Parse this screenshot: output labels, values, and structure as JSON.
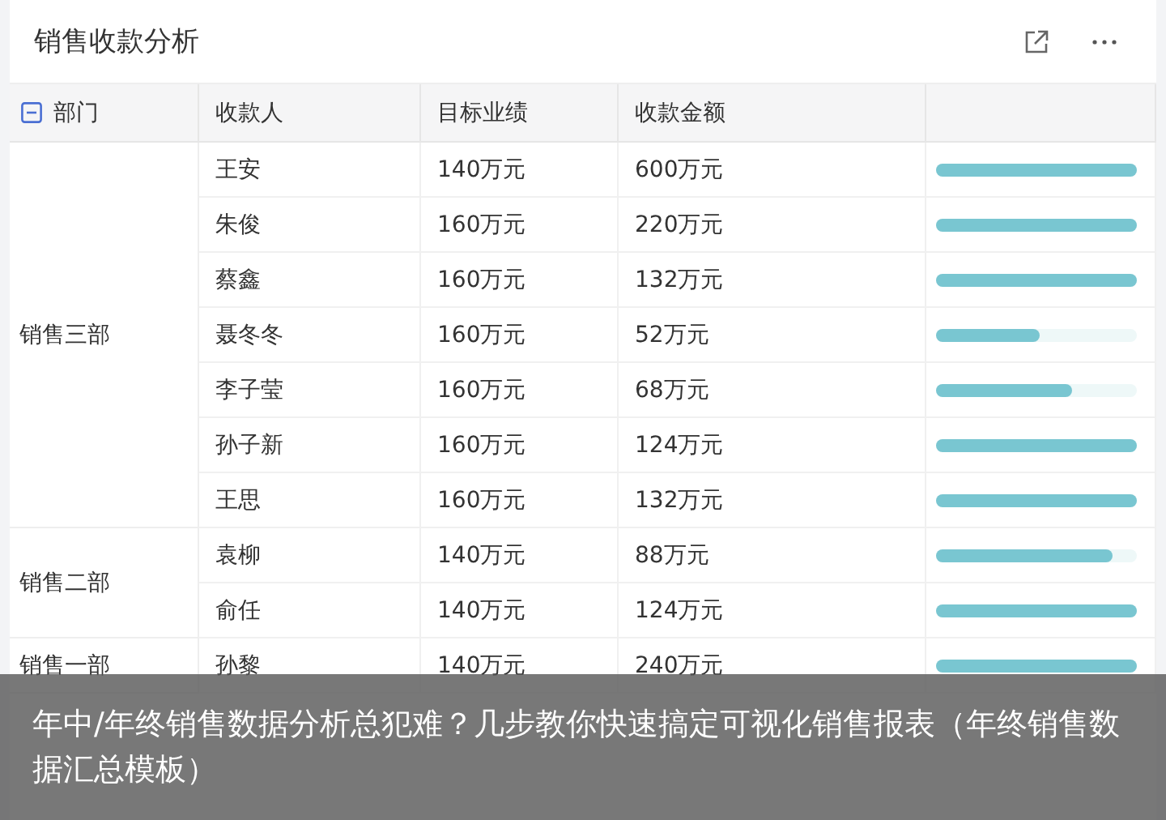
{
  "card": {
    "title": "销售收款分析"
  },
  "table": {
    "columns": [
      "部门",
      "收款人",
      "目标业绩",
      "收款金额"
    ],
    "groups": [
      {
        "department": "销售三部",
        "rows": [
          {
            "payee": "王安",
            "target": "140万元",
            "amount": "600万元",
            "level": 1
          },
          {
            "payee": "朱俊",
            "target": "160万元",
            "amount": "220万元",
            "level": 1
          },
          {
            "payee": "蔡鑫",
            "target": "160万元",
            "amount": "132万元",
            "level": 1
          },
          {
            "payee": "聂冬冬",
            "target": "160万元",
            "amount": "52万元",
            "level": 0.52
          },
          {
            "payee": "李子莹",
            "target": "160万元",
            "amount": "68万元",
            "level": 0.68
          },
          {
            "payee": "孙子新",
            "target": "160万元",
            "amount": "124万元",
            "level": 1
          },
          {
            "payee": "王思",
            "target": "160万元",
            "amount": "132万元",
            "level": 1
          }
        ]
      },
      {
        "department": "销售二部",
        "rows": [
          {
            "payee": "袁柳",
            "target": "140万元",
            "amount": "88万元",
            "level": 0.88
          },
          {
            "payee": "俞任",
            "target": "140万元",
            "amount": "124万元",
            "level": 1
          }
        ]
      },
      {
        "department": "销售一部",
        "rows": [
          {
            "payee": "孙黎",
            "target": "140万元",
            "amount": "240万元",
            "level": 1
          }
        ]
      }
    ]
  },
  "caption": "年中/年终销售数据分析总犯难？几步教你快速搞定可视化销售报表（年终销售数据汇总模板）"
}
